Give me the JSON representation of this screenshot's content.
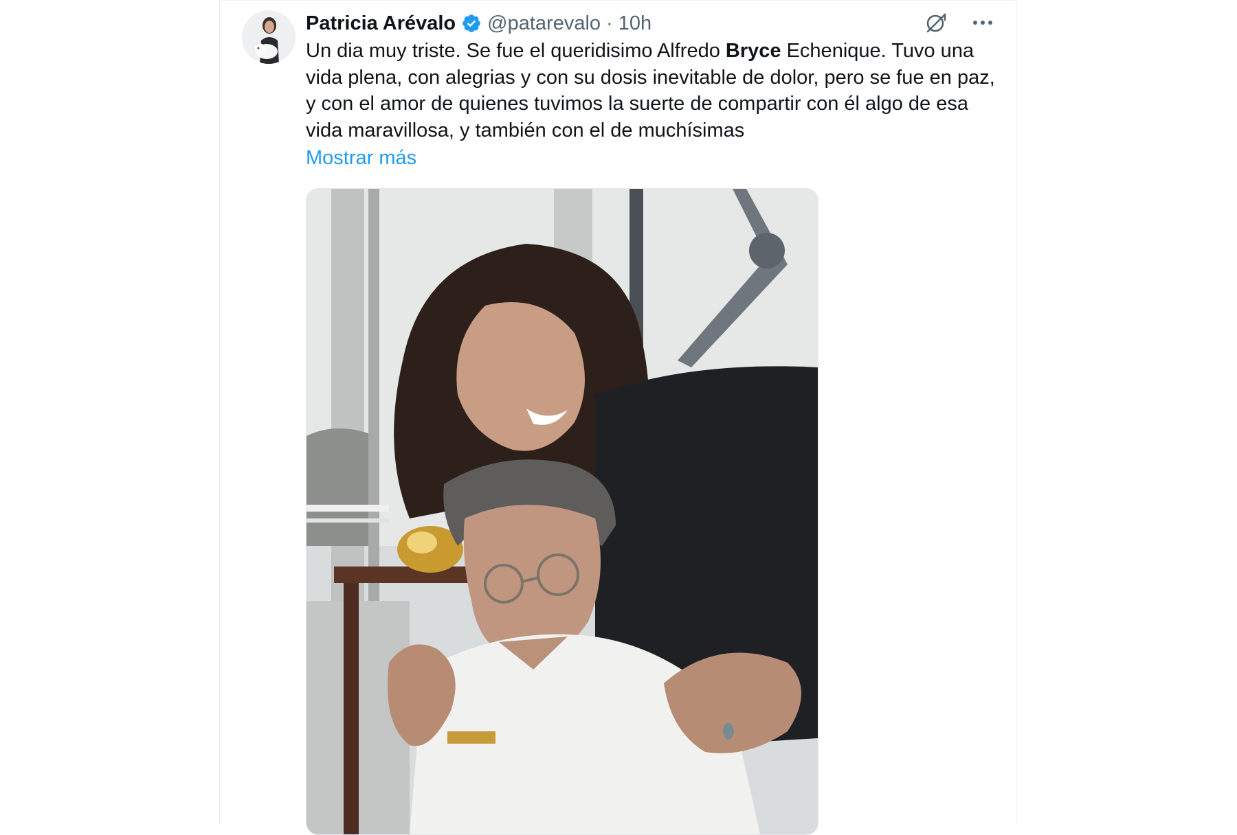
{
  "tweet": {
    "author": {
      "display_name": "Patricia Arévalo",
      "handle": "@patarevalo",
      "verified": true
    },
    "separator": "·",
    "time": "10h",
    "text": {
      "part1": "Un dia muy triste. Se fue el queridisimo Alfredo ",
      "bold": "Bryce",
      "part2": " Echenique. Tuvo una vida plena, con alegrias y con su dosis inevitable de dolor, pero se fue en paz, y con el amor de quienes tuvimos la suerte de compartir con él algo de esa vida maravillosa, y también con el de muchísimas"
    },
    "show_more": "Mostrar más",
    "icons": {
      "grok": "grok-icon",
      "more": "more-icon",
      "verified": "verified-badge-icon"
    }
  },
  "colors": {
    "link": "#1d9bf0",
    "verified": "#1d9bf0",
    "secondary_text": "#536471",
    "primary_text": "#0f1419"
  }
}
